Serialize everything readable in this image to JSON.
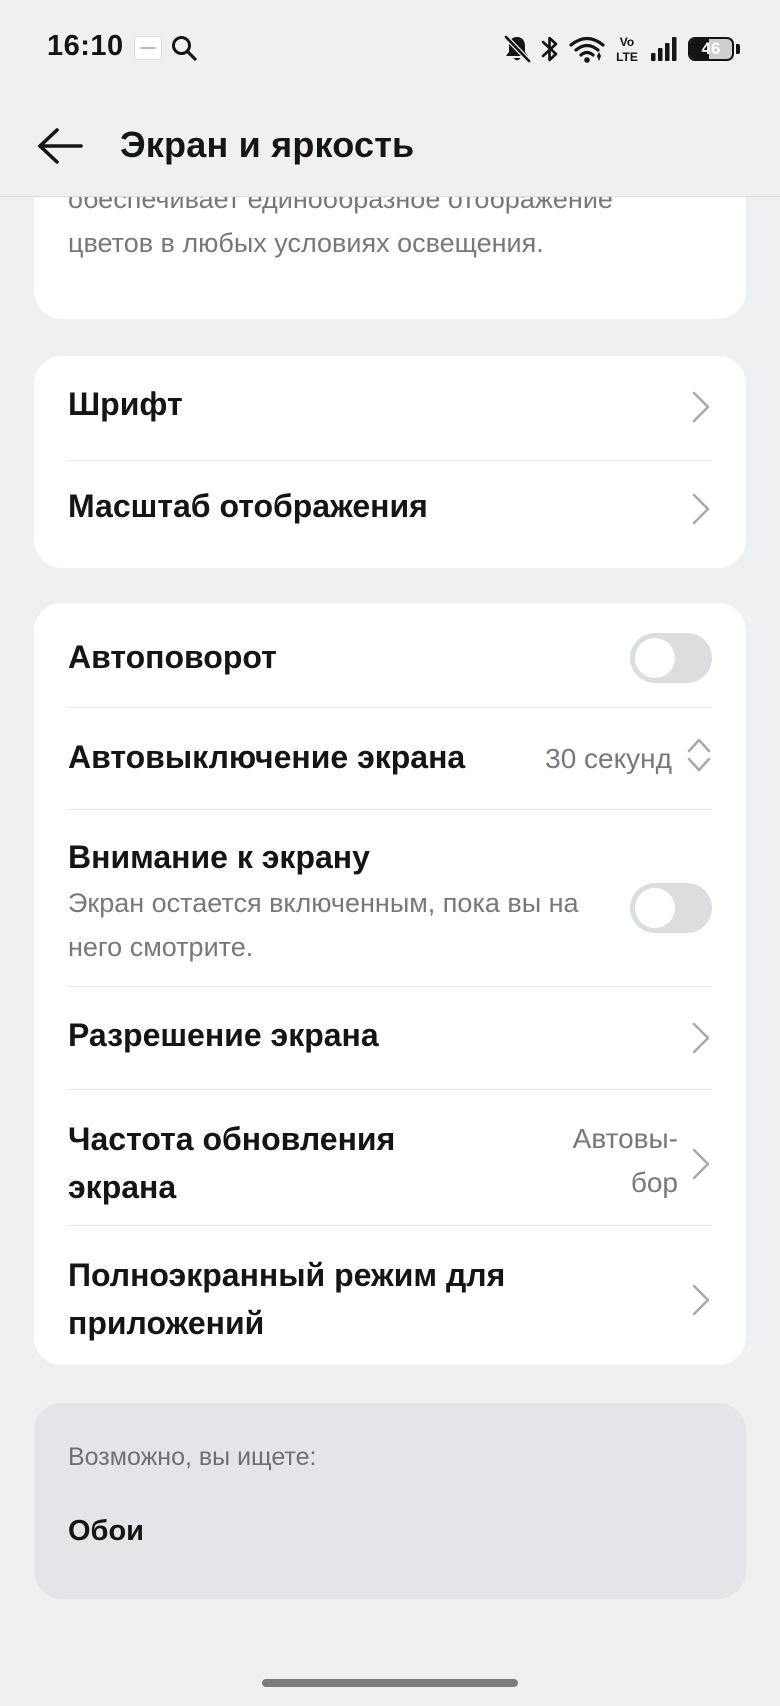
{
  "status_bar": {
    "time": "16:10",
    "battery_percent": "46",
    "battery_level": 0.46,
    "network_label_top": "Vo",
    "network_label_bottom": "LTE",
    "icons": [
      "notification-app-icon",
      "search-icon",
      "muted-bell-icon",
      "bluetooth-icon",
      "wifi-icon",
      "volte-icon",
      "signal-icon",
      "battery-icon"
    ]
  },
  "header": {
    "title": "Экран и яркость",
    "back_icon": "arrow-left-icon"
  },
  "top_card": {
    "description": "обеспечивает единообразное отображение цветов в любых условиях освещения."
  },
  "font_card": {
    "items": [
      {
        "label": "Шрифт"
      },
      {
        "label": "Масштаб отображения"
      }
    ]
  },
  "display_card": {
    "auto_rotate": {
      "label": "Автоповорот",
      "enabled": false
    },
    "screen_timeout": {
      "label": "Автовыключение экрана",
      "value": "30 секунд"
    },
    "screen_attention": {
      "label": "Внимание к экрану",
      "description": "Экран остается включенным, пока вы на него смотрите.",
      "enabled": false
    },
    "resolution": {
      "label": "Разрешение экрана"
    },
    "refresh_rate": {
      "label_line1": "Частота обновления",
      "label_line2": "экрана",
      "value_line1": "Автовы-",
      "value_line2": "бор"
    },
    "fullscreen_apps": {
      "label_line1": "Полноэкранный режим для",
      "label_line2": "приложений"
    }
  },
  "suggestions": {
    "heading": "Возможно, вы ищете:",
    "items": [
      {
        "label": "Обои"
      }
    ]
  },
  "colors": {
    "background": "#eff0f2",
    "card": "#ffffff",
    "suggestion_card": "#e4e5e8",
    "secondary_text": "#77787b",
    "toggle_off": "#dcdddf"
  }
}
